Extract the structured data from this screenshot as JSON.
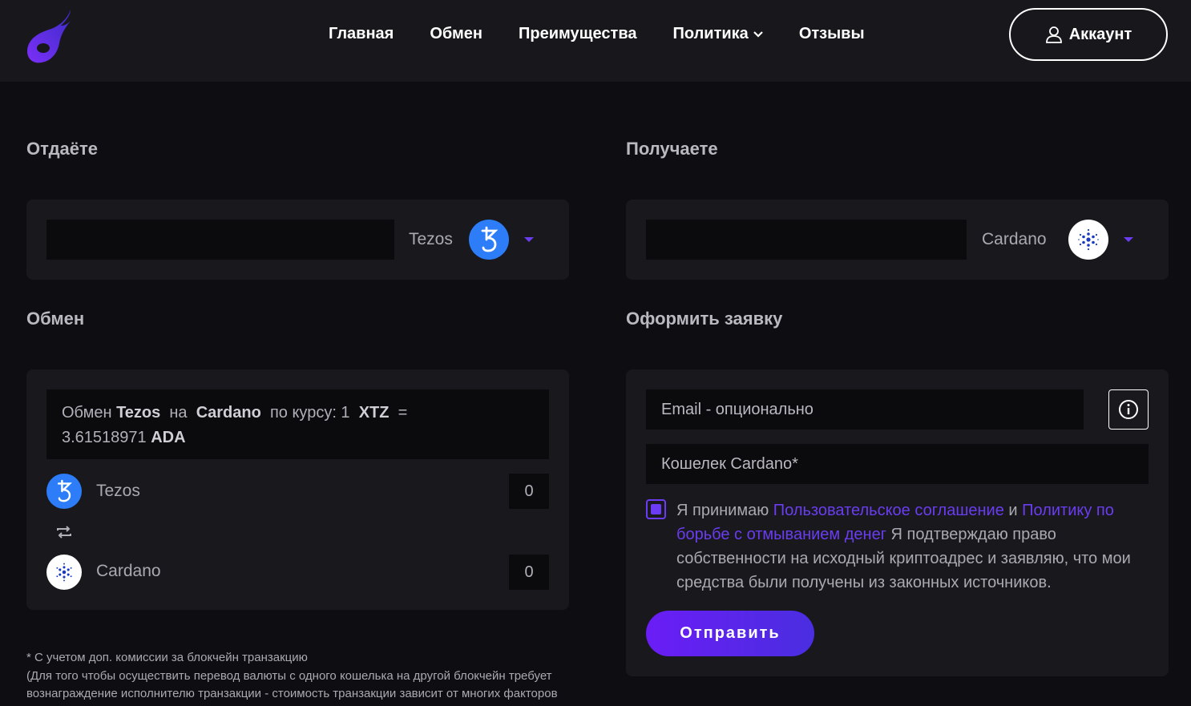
{
  "nav": {
    "items": [
      {
        "label": "Главная"
      },
      {
        "label": "Обмен"
      },
      {
        "label": "Преимущества"
      },
      {
        "label": "Политика"
      },
      {
        "label": "Отзывы"
      }
    ],
    "account_label": "Аккаунт"
  },
  "give": {
    "title": "Отдаёте",
    "currency": "Tezos",
    "amount": ""
  },
  "receive": {
    "title": "Получаете",
    "currency": "Cardano",
    "amount": ""
  },
  "exchange": {
    "title": "Обмен",
    "rate": {
      "prefix": "Обмен",
      "from": "Tezos",
      "on": "на",
      "to": "Cardano",
      "by_rate": "по курсу: 1",
      "from_ticker": "XTZ",
      "eq": "=",
      "value": "3.61518971",
      "to_ticker": "ADA"
    },
    "rows": [
      {
        "name": "Tezos",
        "amount": "0"
      },
      {
        "name": "Cardano",
        "amount": "0"
      }
    ]
  },
  "order": {
    "title": "Оформить заявку",
    "email_placeholder": "Email - опционально",
    "wallet_placeholder": "Кошелек Cardano*",
    "agree_prefix": "Я принимаю",
    "agree_link1": "Пользовательское соглашение",
    "agree_and": "и",
    "agree_link2": "Политику по борьбе с отмыванием денег",
    "agree_rest": "Я подтверждаю право собственности на исходный криптоадрес и заявляю, что мои средства были получены из законных источников.",
    "checked": true,
    "submit_label": "Отправить"
  },
  "footnote": {
    "line1": "* С учетом доп. комиссии за блокчейн транзакцию",
    "line2": "(Для того чтобы осуществить перевод валюты с одного кошелька на другой блокчейн требует вознаграждение исполнителю транзакции - стоимость транзакции зависит от многих факторов"
  },
  "colors": {
    "accent": "#6a3df0",
    "tezos": "#2c7df7",
    "background": "#0e0e12",
    "card": "#18181d"
  },
  "icons": {
    "logo": "flame-logo-icon",
    "account": "user-icon",
    "politics_dropdown": "chevron-down-icon",
    "info": "info-icon",
    "swap": "swap-icon"
  }
}
